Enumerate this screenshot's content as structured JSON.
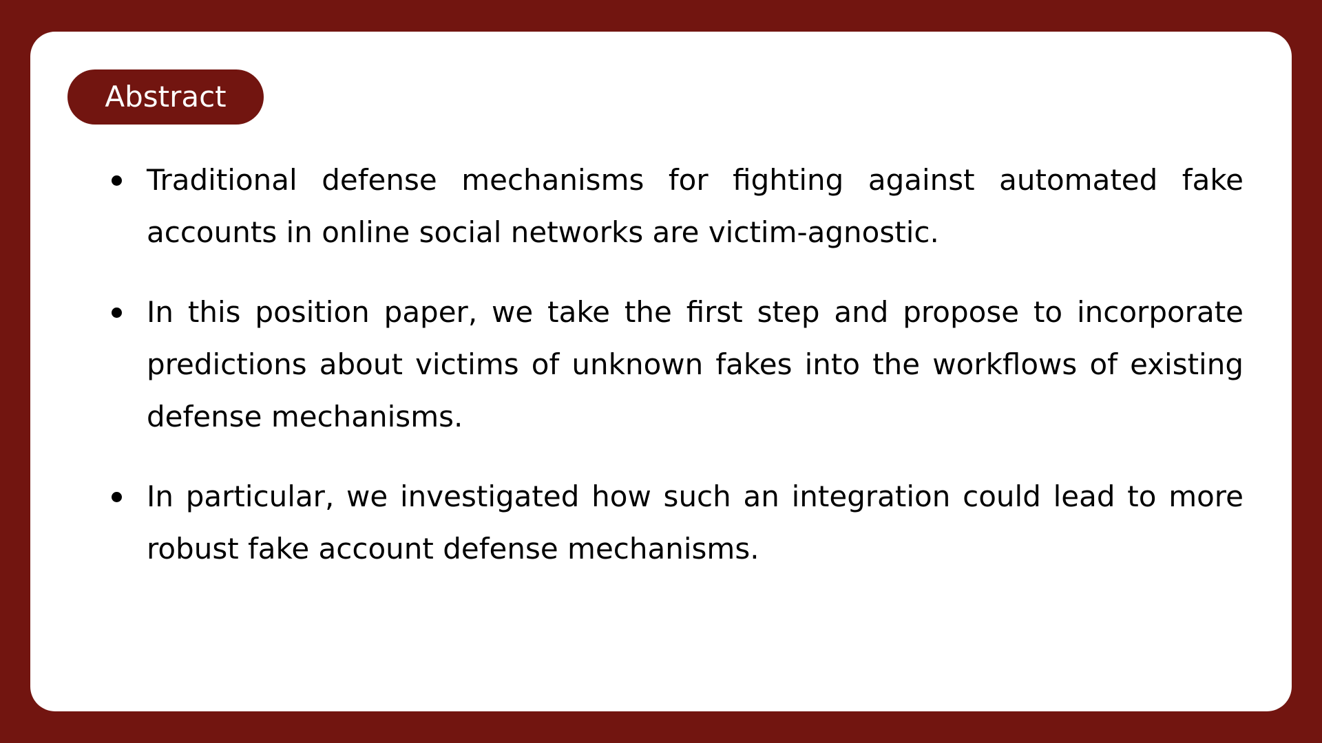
{
  "slide": {
    "tag_label": "Abstract",
    "bullets": [
      "Traditional defense mechanisms for fighting against automated fake accounts in online social networks are victim-agnostic.",
      "In this position paper, we take the first step and propose to incorporate predictions about victims of unknown fakes into the workflows of existing defense mechanisms.",
      "In particular, we investigated how such an integration could lead to more robust fake account defense mechanisms."
    ]
  },
  "colors": {
    "accent": "#721510",
    "card": "#ffffff",
    "text": "#000000"
  }
}
